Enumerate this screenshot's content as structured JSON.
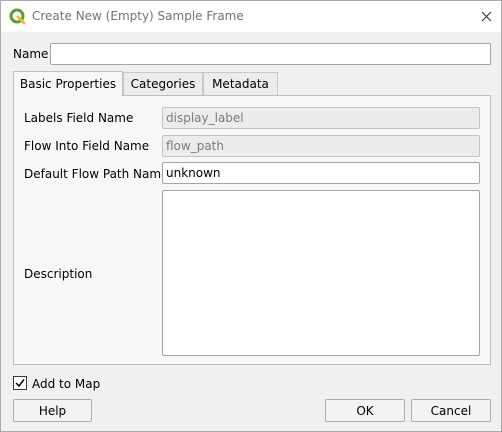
{
  "window": {
    "title": "Create New (Empty) Sample Frame"
  },
  "form": {
    "name_label": "Name",
    "name_value": ""
  },
  "tabs": [
    {
      "label": "Basic Properties",
      "active": true
    },
    {
      "label": "Categories",
      "active": false
    },
    {
      "label": "Metadata",
      "active": false
    }
  ],
  "basic_properties": {
    "labels_field_label": "Labels Field Name",
    "labels_field_value": "display_label",
    "flow_into_label": "Flow Into Field Name",
    "flow_into_value": "flow_path",
    "default_flow_label": "Default Flow Path Name",
    "default_flow_value": "unknown",
    "description_label": "Description",
    "description_value": ""
  },
  "footer": {
    "add_to_map_label": "Add to Map",
    "add_to_map_checked": true,
    "help_label": "Help",
    "ok_label": "OK",
    "cancel_label": "Cancel"
  },
  "colors": {
    "brand_green": "#5a9e33",
    "disabled_field": "#ececec"
  },
  "icons": {
    "app": "qgis-logo-icon",
    "close": "close-icon",
    "checkbox": "checkmark-icon"
  }
}
